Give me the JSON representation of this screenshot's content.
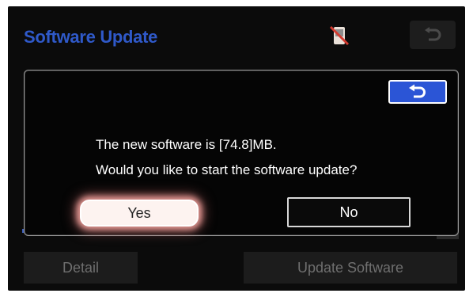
{
  "header": {
    "title": "Software Update",
    "status_icon": "phone-disconnected-icon",
    "back_icon": "back-arrow-icon"
  },
  "background": {
    "faint_row": "— ——— ———— ——— ———— ———————",
    "detail_button": "Detail",
    "update_button": "Update Software"
  },
  "dialog": {
    "back_icon": "back-arrow-icon",
    "message_line1": "The new software is [74.8]MB.",
    "message_line2": "Would you like to start the software update?",
    "yes_label": "Yes",
    "no_label": "No"
  },
  "colors": {
    "title_blue": "#2f59c9",
    "accent_blue": "#2b55d6",
    "yes_glow": "#e69b96"
  }
}
